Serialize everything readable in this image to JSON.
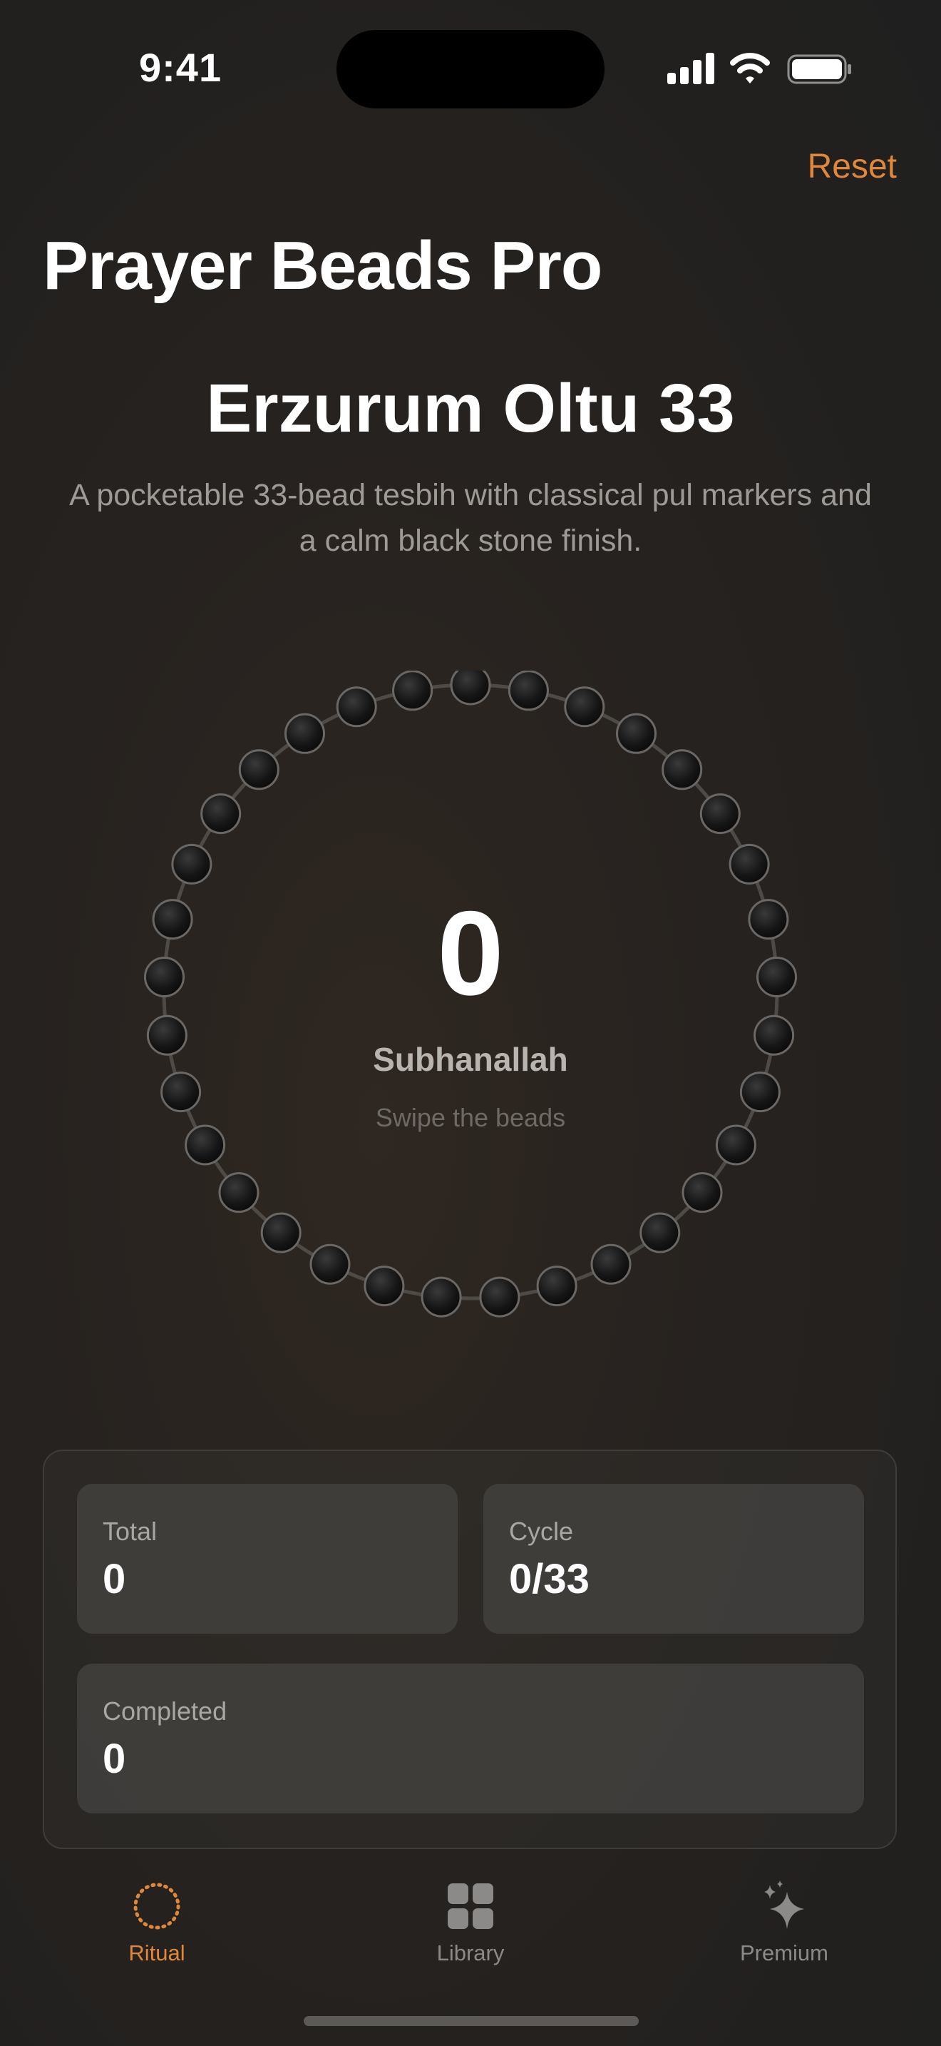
{
  "status_bar": {
    "time": "9:41"
  },
  "header": {
    "reset_label": "Reset",
    "app_title": "Prayer Beads Pro"
  },
  "tesbih": {
    "name": "Erzurum Oltu 33",
    "description": "A pocketable 33-bead tesbih with classical pul markers and a calm black stone finish.",
    "bead_count": 33,
    "count": "0",
    "dhikr": "Subhanallah",
    "hint": "Swipe the beads"
  },
  "stats": {
    "total_label": "Total",
    "total_value": "0",
    "cycle_label": "Cycle",
    "cycle_value": "0/33",
    "completed_label": "Completed",
    "completed_value": "0"
  },
  "tabs": [
    {
      "label": "Ritual",
      "icon": "beads-ring-icon",
      "active": true
    },
    {
      "label": "Library",
      "icon": "grid-icon",
      "active": false
    },
    {
      "label": "Premium",
      "icon": "sparkles-icon",
      "active": false
    }
  ],
  "colors": {
    "accent": "#e0873a",
    "background": "#23201e",
    "inactive": "#8c8a88"
  }
}
